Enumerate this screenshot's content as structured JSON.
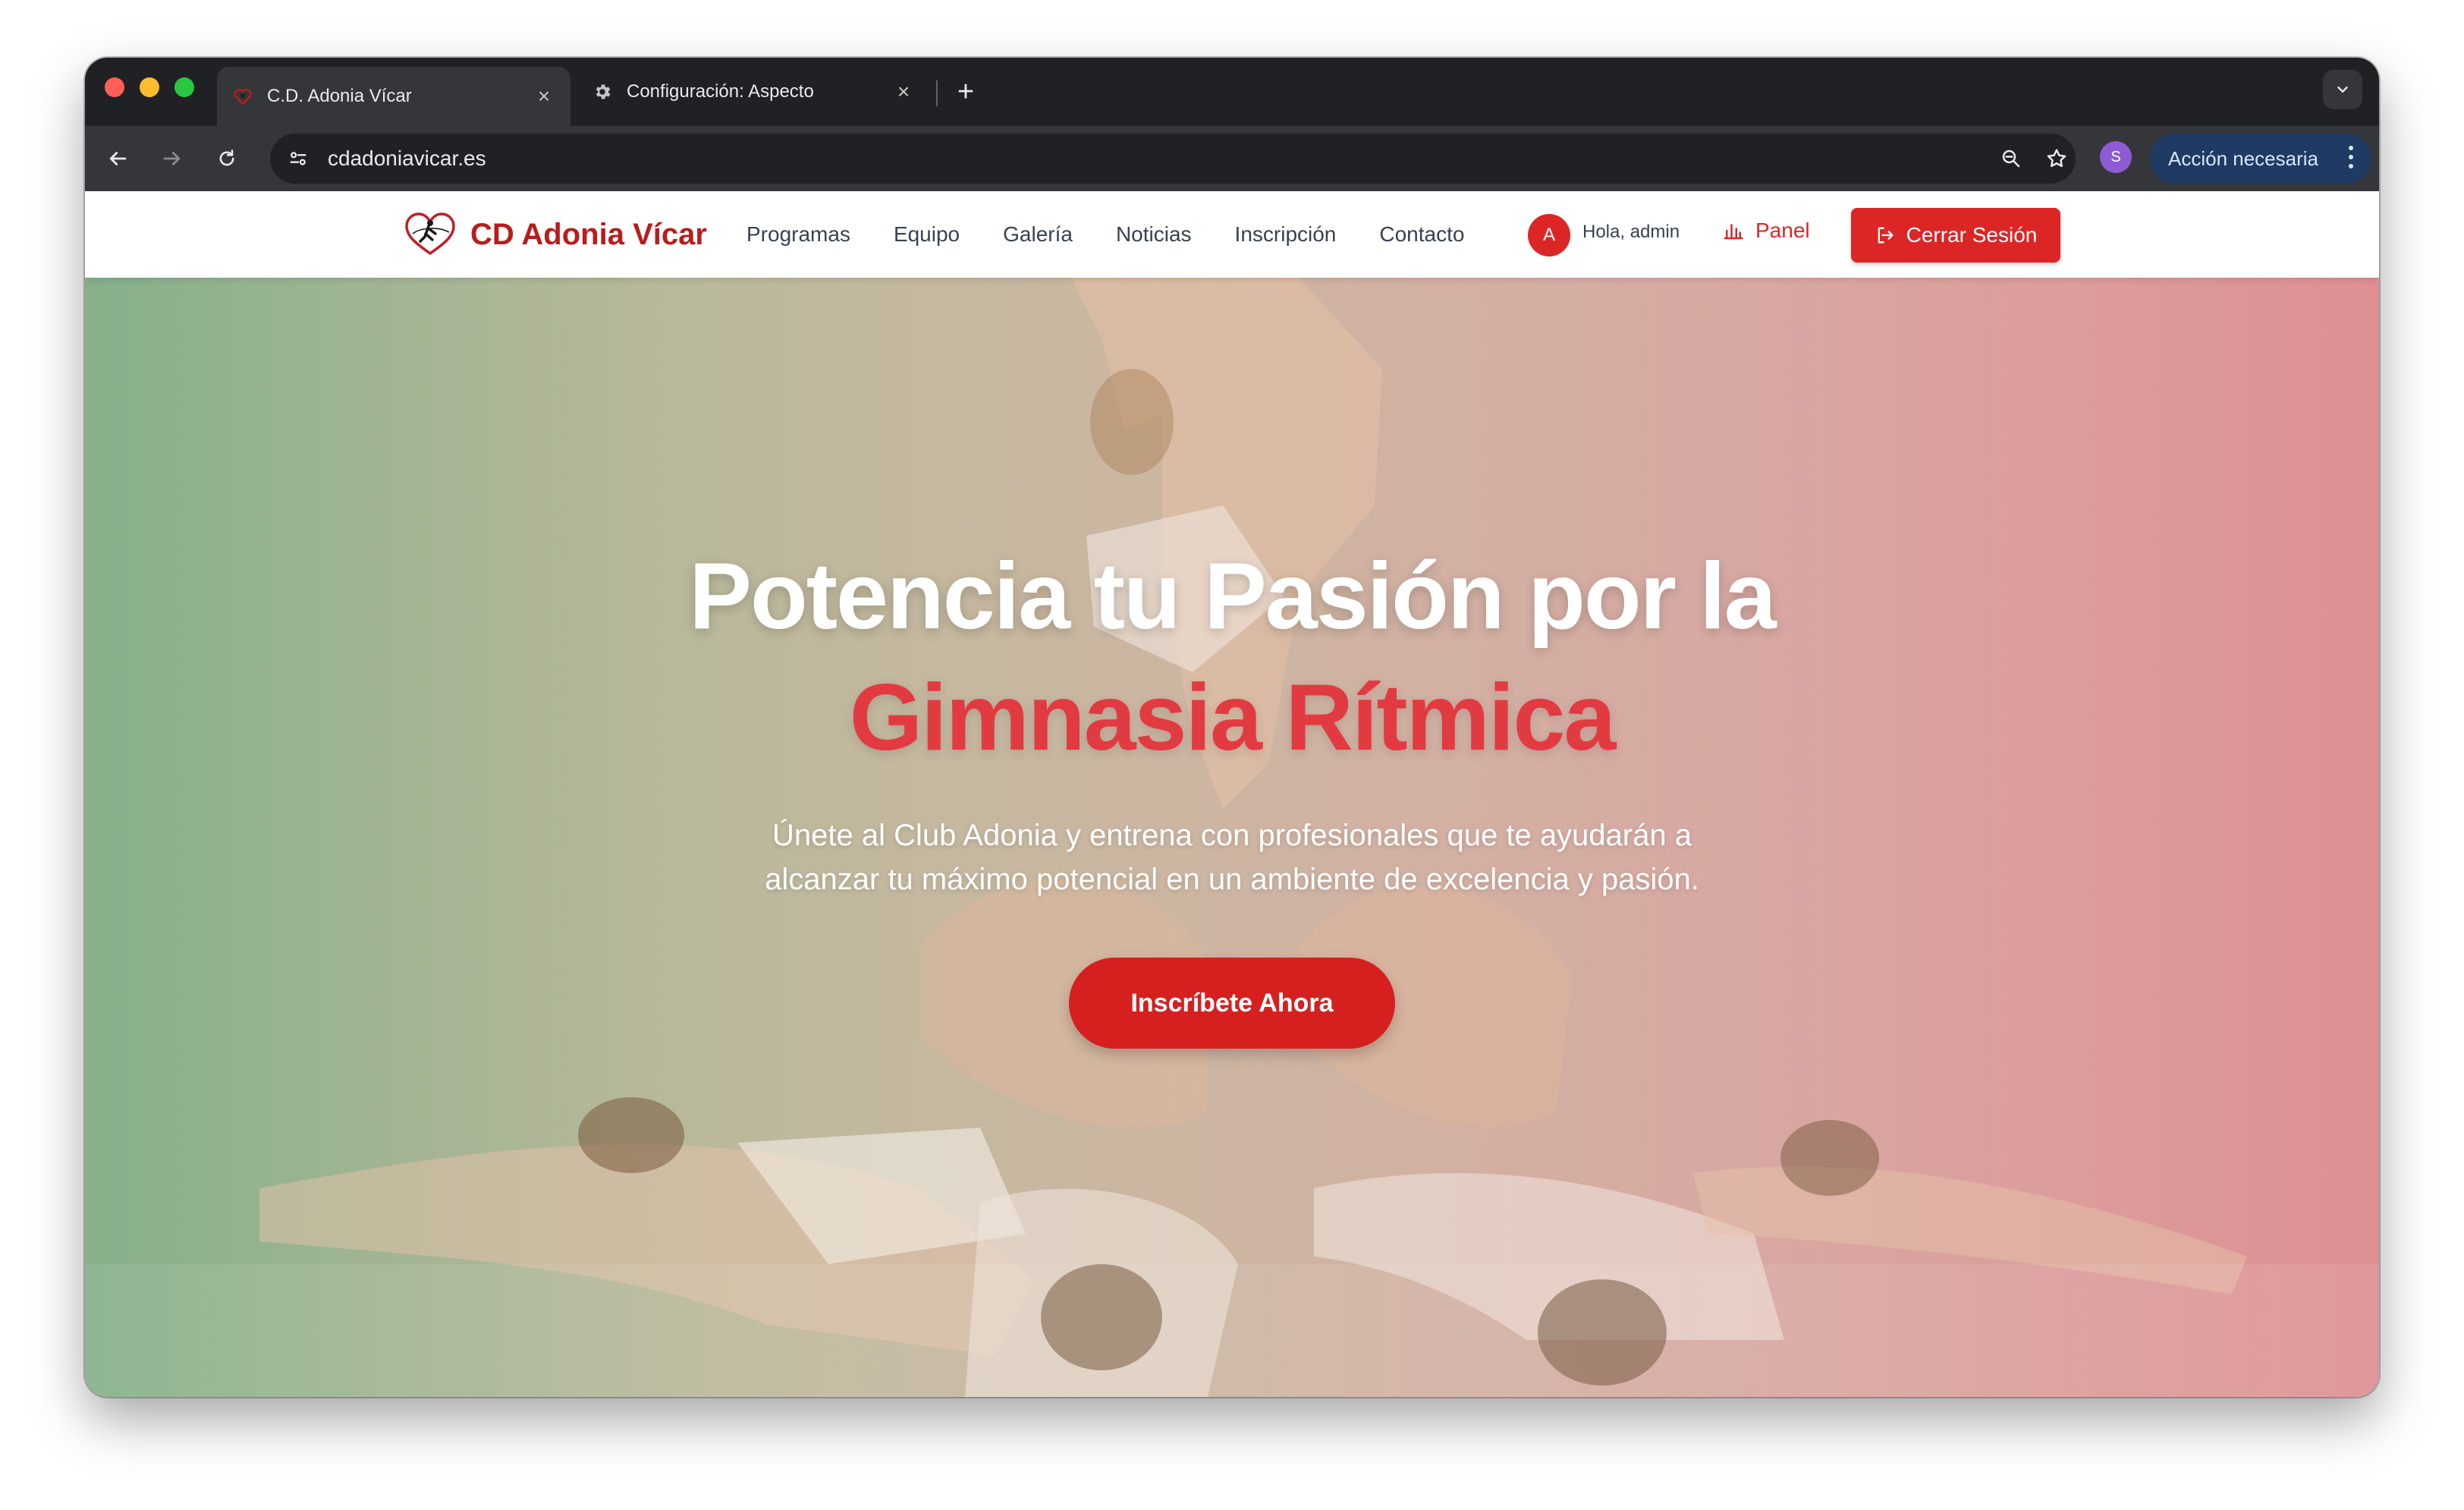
{
  "browser": {
    "tabs": [
      {
        "title": "C.D. Adonia Vícar",
        "active": true
      },
      {
        "title": "Configuración: Aspecto",
        "active": false
      }
    ],
    "url": "cdadoniavicar.es",
    "profile_initial": "S",
    "action_label": "Acción necesaria"
  },
  "site": {
    "brand": "CD Adonia Vícar",
    "menu": [
      "Programas",
      "Equipo",
      "Galería",
      "Noticias",
      "Inscripción",
      "Contacto"
    ],
    "user_initial": "A",
    "greeting": "Hola, admin",
    "panel_label": "Panel",
    "logout_label": "Cerrar Sesión"
  },
  "hero": {
    "title_line1": "Potencia tu Pasión por la",
    "title_line2": "Gimnasia Rítmica",
    "subtitle_line1": "Únete al Club Adonia y entrena con profesionales que te ayudarán a",
    "subtitle_line2": "alcanzar tu máximo potencial en un ambiente de excelencia y pasión.",
    "cta_label": "Inscríbete Ahora"
  },
  "colors": {
    "brand_red": "#dc2626",
    "title_red": "#e13b41",
    "gradient_left": "#8fb491",
    "gradient_right": "#d98f93"
  }
}
